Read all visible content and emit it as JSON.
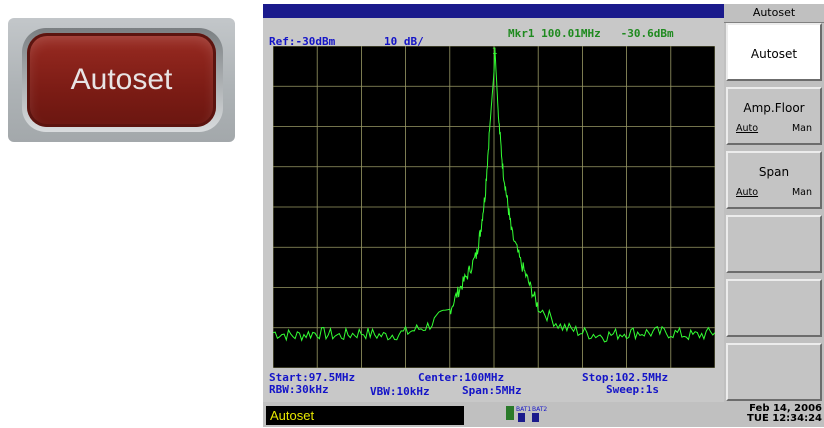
{
  "hardware_key": {
    "label": "Autoset"
  },
  "screen": {
    "ref_level": "Ref:-30dBm",
    "scale": "10 dB/",
    "marker": {
      "name": "Mkr1",
      "frequency": "100.01MHz",
      "level": "-30.6dBm",
      "index_label": "1"
    },
    "start": "Start:97.5MHz",
    "center": "Center:100MHz",
    "stop": "Stop:102.5MHz",
    "rbw": "RBW:30kHz",
    "vbw": "VBW:10kHz",
    "span": "Span:5MHz",
    "sweep": "Sweep:1s",
    "status_message": "Autoset",
    "battery_labels": [
      "BAT1",
      "BAT2"
    ]
  },
  "softkeys": {
    "title": "Autoset",
    "items": [
      {
        "label": "Autoset",
        "active": true
      },
      {
        "label": "Amp.Floor",
        "auto": "Auto",
        "man": "Man"
      },
      {
        "label": "Span",
        "auto": "Auto",
        "man": "Man"
      },
      {
        "label": ""
      },
      {
        "label": ""
      },
      {
        "label": ""
      }
    ]
  },
  "datetime": {
    "date": "Feb 14, 2006",
    "time": "TUE 12:34:24"
  },
  "colors": {
    "trace": "#33ff33",
    "grid": "#9a9a66",
    "header_blue": "#1414c8",
    "header_green": "#1f8a1f",
    "status_text": "#e8e800"
  },
  "chart_data": {
    "type": "line",
    "x_range_mhz": [
      97.5,
      102.5
    ],
    "y_range_dbm": [
      -30,
      -130
    ],
    "grid": true,
    "x": [
      97.5,
      97.75,
      98.0,
      98.25,
      98.5,
      98.75,
      99.0,
      99.25,
      99.5,
      99.6,
      99.7,
      99.8,
      99.85,
      99.9,
      99.95,
      100.0,
      100.01,
      100.05,
      100.1,
      100.15,
      100.2,
      100.3,
      100.4,
      100.5,
      100.75,
      101.0,
      101.25,
      101.5,
      101.75,
      102.0,
      102.25,
      102.5
    ],
    "y": [
      -119,
      -120,
      -119,
      -120,
      -119,
      -120,
      -119,
      -117,
      -112,
      -106,
      -101,
      -95,
      -87,
      -76,
      -56,
      -38,
      -30.6,
      -52,
      -68,
      -78,
      -88,
      -97,
      -104,
      -111,
      -117,
      -119,
      -120,
      -119,
      -119,
      -119,
      -120,
      -119
    ]
  }
}
